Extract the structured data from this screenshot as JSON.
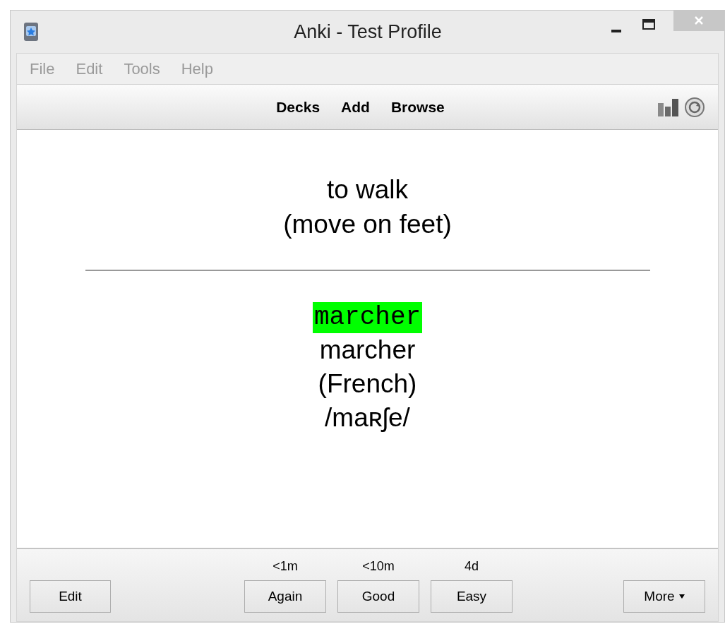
{
  "window": {
    "title": "Anki - Test Profile"
  },
  "menu": [
    "File",
    "Edit",
    "Tools",
    "Help"
  ],
  "toolbar": [
    "Decks",
    "Add",
    "Browse"
  ],
  "card": {
    "front": [
      "to walk",
      "(move on feet)"
    ],
    "back": [
      {
        "text": "marcher",
        "kind": "typed"
      },
      {
        "text": "marcher",
        "kind": "plain"
      },
      {
        "text": "(French)",
        "kind": "plain"
      },
      {
        "text": "/maʀʃe/",
        "kind": "plain"
      }
    ]
  },
  "bottom": {
    "edit": "Edit",
    "answers": [
      {
        "interval": "<1m",
        "label": "Again"
      },
      {
        "interval": "<10m",
        "label": "Good"
      },
      {
        "interval": "4d",
        "label": "Easy"
      }
    ],
    "more": "More"
  }
}
